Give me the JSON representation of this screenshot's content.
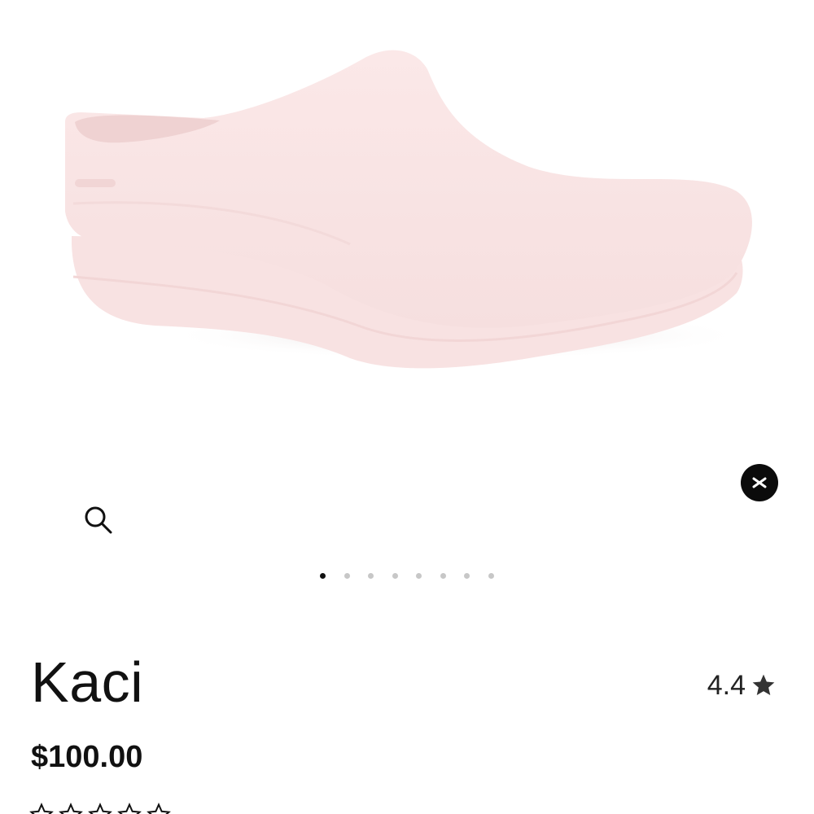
{
  "product": {
    "name": "Kaci",
    "price": "$100.00",
    "rating": "4.4",
    "image_alt": "pink clog shoe"
  },
  "gallery": {
    "total_images": 8,
    "active_index": 0
  },
  "controls": {
    "zoom_icon": "magnifier-icon",
    "close_icon": "close-icon"
  },
  "colors": {
    "shoe": "#f8e3e3",
    "accent": "#111111",
    "dot_inactive": "#c7c7c7"
  }
}
